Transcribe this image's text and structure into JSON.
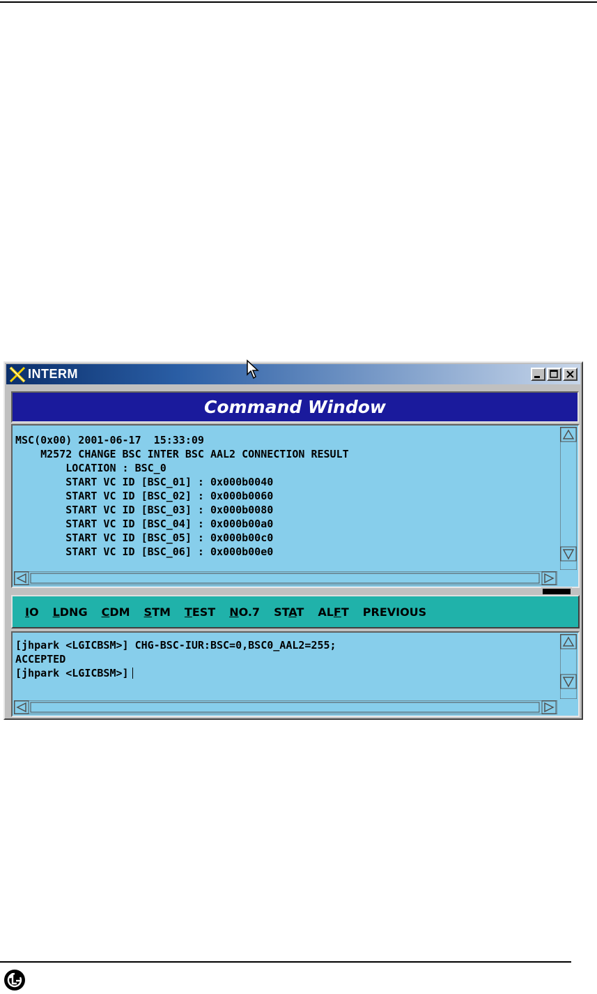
{
  "window": {
    "title": "INTERM",
    "banner": "Command Window"
  },
  "output": {
    "lines": [
      "MSC(0x00) 2001-06-17  15:33:09",
      "    M2572 CHANGE BSC INTER BSC AAL2 CONNECTION RESULT",
      "        LOCATION : BSC_0",
      "        START VC ID [BSC_01] : 0x000b0040",
      "        START VC ID [BSC_02] : 0x000b0060",
      "        START VC ID [BSC_03] : 0x000b0080",
      "        START VC ID [BSC_04] : 0x000b00a0",
      "        START VC ID [BSC_05] : 0x000b00c0",
      "        START VC ID [BSC_06] : 0x000b00e0"
    ]
  },
  "menu": {
    "items": [
      {
        "pre": "",
        "key": "I",
        "post": "O"
      },
      {
        "pre": "",
        "key": "L",
        "post": "DNG"
      },
      {
        "pre": "",
        "key": "C",
        "post": "DM"
      },
      {
        "pre": "",
        "key": "S",
        "post": "TM"
      },
      {
        "pre": "",
        "key": "T",
        "post": "EST"
      },
      {
        "pre": "",
        "key": "N",
        "post": "O.7"
      },
      {
        "pre": "ST",
        "key": "A",
        "post": "T"
      },
      {
        "pre": "AL",
        "key": "F",
        "post": "T"
      },
      {
        "pre": "PREVIOUS",
        "key": "",
        "post": ""
      }
    ]
  },
  "console": {
    "lines": [
      "[jhpark <LGICBSM>] CHG-BSC-IUR:BSC=0,BSC0_AAL2=255;",
      "ACCEPTED",
      "[jhpark <LGICBSM>]"
    ]
  },
  "colors": {
    "title_bar": "#0b2f6b",
    "banner": "#1a1a9c",
    "pane": "#87ceeb",
    "menubar": "#20b2aa"
  },
  "icons": [
    "x-app-icon",
    "minimize-icon",
    "maximize-icon",
    "close-icon",
    "arrow-up-icon",
    "arrow-down-icon",
    "arrow-left-icon",
    "arrow-right-icon",
    "mouse-pointer-icon",
    "lg-logo-icon"
  ]
}
